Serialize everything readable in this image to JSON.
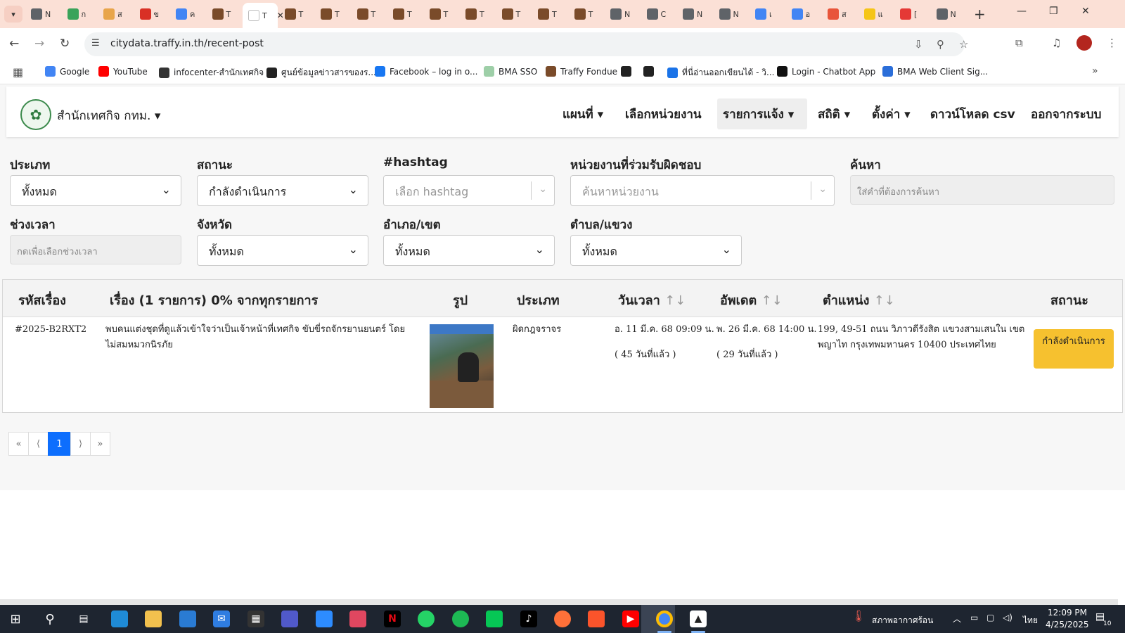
{
  "browser": {
    "tabs": [
      {
        "label": "N",
        "color": "#5f6368"
      },
      {
        "label": "ก",
        "color": "#3aa35a"
      },
      {
        "label": "ส",
        "color": "#e8a54b"
      },
      {
        "label": "ข",
        "color": "#d93025"
      },
      {
        "label": "ค",
        "color": "#4285f4"
      },
      {
        "label": "T",
        "color": "#7a4b2a"
      },
      {
        "label": "T",
        "color": "#ffffff"
      },
      {
        "label": "T",
        "color": "#7a4b2a"
      },
      {
        "label": "T",
        "color": "#7a4b2a"
      },
      {
        "label": "T",
        "color": "#7a4b2a"
      },
      {
        "label": "T",
        "color": "#7a4b2a"
      },
      {
        "label": "T",
        "color": "#7a4b2a"
      },
      {
        "label": "T",
        "color": "#7a4b2a"
      },
      {
        "label": "T",
        "color": "#7a4b2a"
      },
      {
        "label": "T",
        "color": "#7a4b2a"
      },
      {
        "label": "T",
        "color": "#7a4b2a"
      },
      {
        "label": "N",
        "color": "#5f6368"
      },
      {
        "label": "C",
        "color": "#5f6368"
      },
      {
        "label": "N",
        "color": "#5f6368"
      },
      {
        "label": "N",
        "color": "#5f6368"
      },
      {
        "label": "เ",
        "color": "#4285f4"
      },
      {
        "label": "อ",
        "color": "#4285f4"
      },
      {
        "label": "ส",
        "color": "#e8553a"
      },
      {
        "label": "แ",
        "color": "#f5c518"
      },
      {
        "label": "[",
        "color": "#e53935"
      },
      {
        "label": "N",
        "color": "#5f6368"
      }
    ],
    "url": "citydata.traffy.in.th/recent-post",
    "bookmarks": [
      {
        "label": "Google",
        "color": "#4285f4"
      },
      {
        "label": "YouTube",
        "color": "#ff0000"
      },
      {
        "label": "infocenter-สำนักเทศกิจ",
        "color": "#333333"
      },
      {
        "label": "ศูนย์ข้อมูลข่าวสารของร...",
        "color": "#222222"
      },
      {
        "label": "Facebook – log in o...",
        "color": "#1877f2"
      },
      {
        "label": "BMA SSO",
        "color": "#9ecfa8"
      },
      {
        "label": "Traffy Fondue",
        "color": "#7a4b2a"
      },
      {
        "label": "",
        "color": "#222222"
      },
      {
        "label": "",
        "color": "#222222"
      },
      {
        "label": "ที่นี่อ่านออกเขียนได้ - วิ...",
        "color": "#1a73e8"
      },
      {
        "label": "Login - Chatbot App",
        "color": "#111111"
      },
      {
        "label": "BMA Web Client Sig...",
        "color": "#2b6ed9"
      }
    ]
  },
  "nav": {
    "brand": "สำนักเทศกิจ กทม.",
    "items": [
      "แผนที่",
      "เลือกหน่วยงาน",
      "รายการแจ้ง",
      "สถิติ",
      "ตั้งค่า",
      "ดาวน์โหลด csv",
      "ออกจากระบบ"
    ]
  },
  "filters": {
    "type_label": "ประเภท",
    "type_value": "ทั้งหมด",
    "status_label": "สถานะ",
    "status_value": "กำลังดำเนินการ",
    "hashtag_label": "#hashtag",
    "hashtag_placeholder": "เลือก hashtag",
    "agency_label": "หน่วยงานที่ร่วมรับผิดชอบ",
    "agency_placeholder": "ค้นหาหน่วยงาน",
    "search_label": "ค้นหา",
    "search_placeholder": "ใส่คำที่ต้องการค้นหา",
    "period_label": "ช่วงเวลา",
    "period_placeholder": "กดเพื่อเลือกช่วงเวลา",
    "province_label": "จังหวัด",
    "province_value": "ทั้งหมด",
    "district_label": "อำเภอ/เขต",
    "district_value": "ทั้งหมด",
    "subdistrict_label": "ตำบล/แขวง",
    "subdistrict_value": "ทั้งหมด"
  },
  "table": {
    "headers": {
      "id": "รหัสเรื่อง",
      "subject": "เรื่อง (1 รายการ) 0% จากทุกรายการ",
      "photo": "รูป",
      "type": "ประเภท",
      "datetime": "วันเวลา",
      "updated": "อัพเดต",
      "location": "ตำแหน่ง",
      "status": "สถานะ"
    },
    "sort_glyph": "↑↓",
    "rows": [
      {
        "id": "#2025-B2RXT2",
        "subject": "พบคนแต่งชุดที่ดูแล้วเข้าใจว่าเป็นเจ้าหน้าที่เทศกิจ ขับขี่รถจักรยานยนตร์ โดยไม่สมหมวกนิรภัย",
        "type": "ผิดกฎจราจร",
        "datetime": "อ. 11 มี.ค. 68 09:09 น.",
        "datetime_ago": "( 45 วันที่แล้ว )",
        "updated": "พ. 26 มี.ค. 68 14:00 น.",
        "updated_ago": "( 29 วันที่แล้ว )",
        "location": "199, 49-51 ถนน วิภาวดีรังสิต แขวงสามเสนใน เขตพญาไท กรุงเทพมหานคร 10400 ประเทศไทย",
        "status": "กำลังดำเนินการ"
      }
    ]
  },
  "pagination": {
    "first": "«",
    "prev": "⟨",
    "current": "1",
    "next": "⟩",
    "last": "»"
  },
  "taskbar": {
    "weather": "สภาพอากาศร้อน",
    "lang": "ไทย",
    "time": "12:09 PM",
    "date": "4/25/2025",
    "notifications": "10"
  }
}
